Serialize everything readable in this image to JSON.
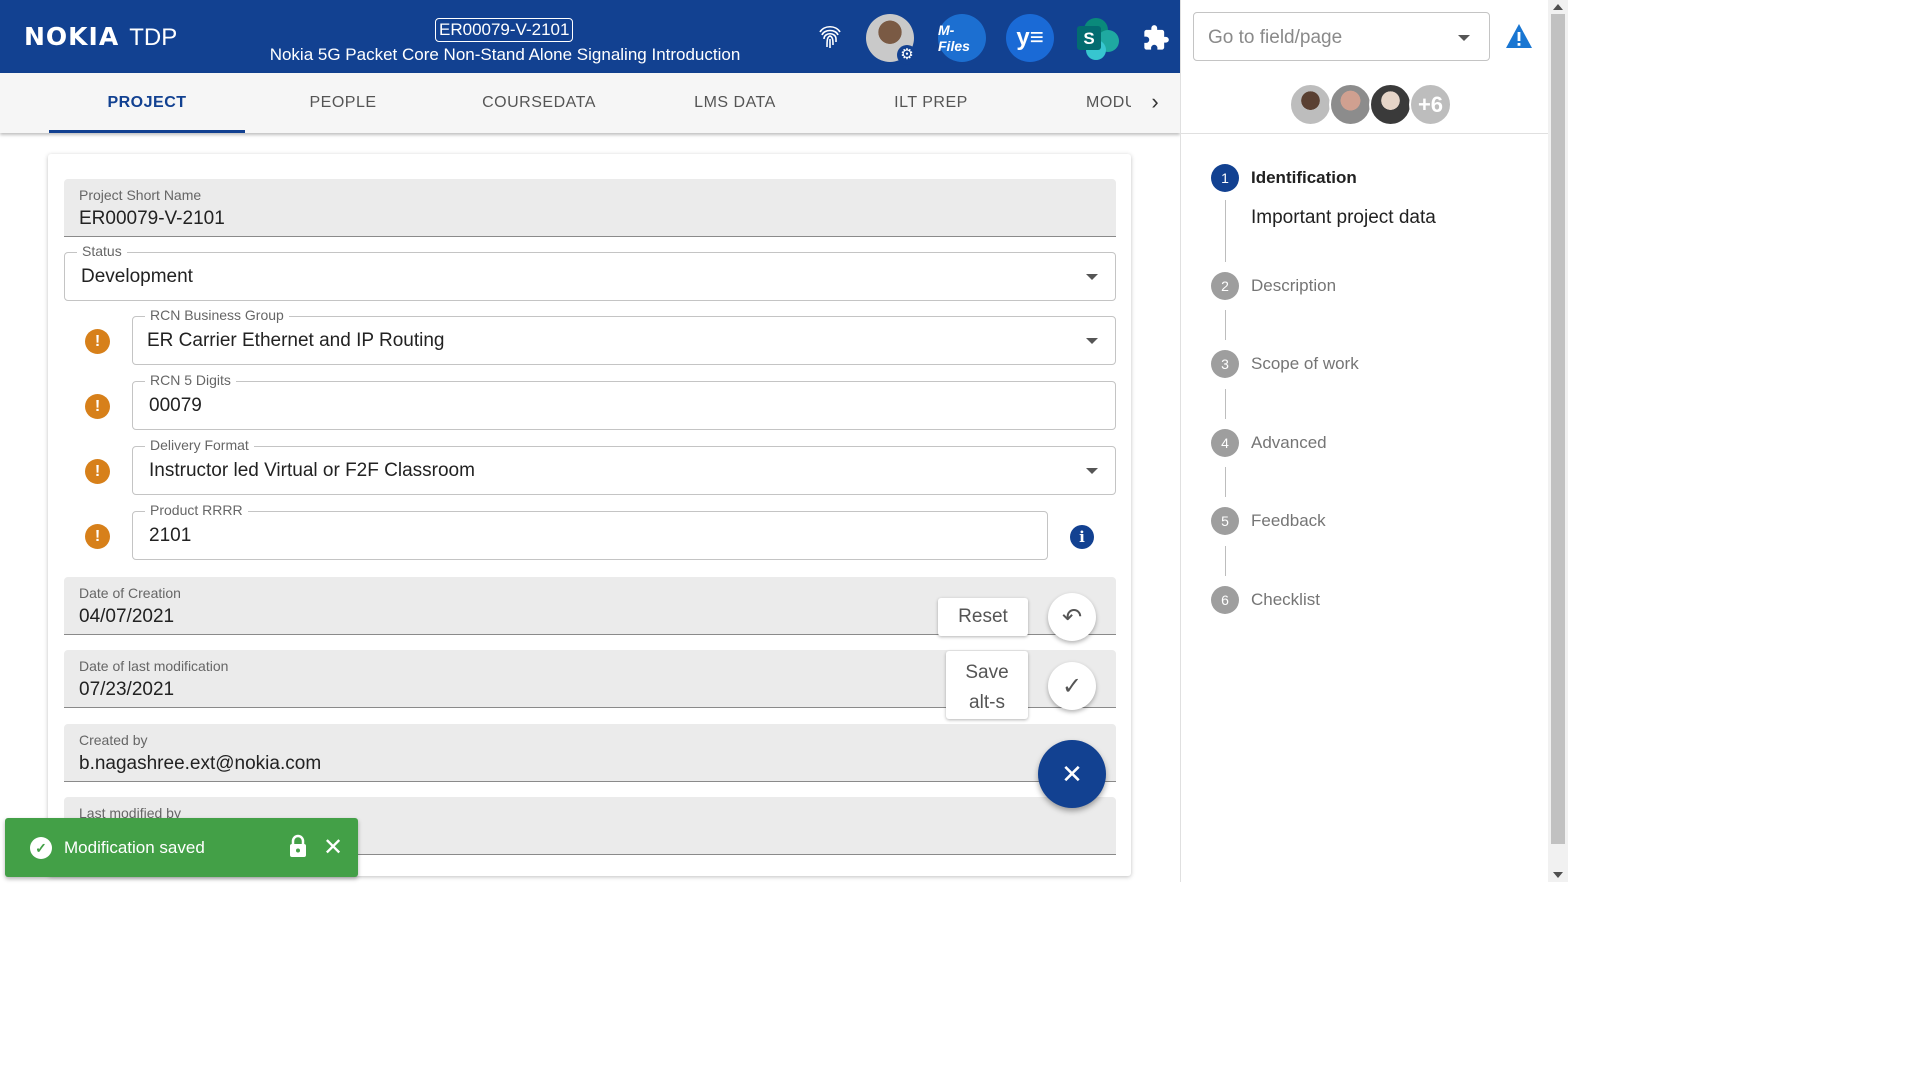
{
  "header": {
    "brand_logo": "NOKIA",
    "brand_app": "TDP",
    "project_id": "ER00079-V-2101",
    "project_title": "Nokia 5G Packet Core Non-Stand Alone Signaling Introduction",
    "mfiles_label": "M-Files",
    "yammer_label": "y≡",
    "sharepoint_label": "S"
  },
  "tabs": [
    {
      "label": "PROJECT",
      "active": true
    },
    {
      "label": "PEOPLE"
    },
    {
      "label": "COURSEDATA"
    },
    {
      "label": "LMS DATA"
    },
    {
      "label": "ILT PREP"
    },
    {
      "label": "MODU"
    }
  ],
  "form": {
    "project_short_name": {
      "label": "Project Short Name",
      "value": "ER00079-V-2101"
    },
    "status": {
      "label": "Status",
      "value": "Development"
    },
    "rcn_business_group": {
      "label": "RCN Business Group",
      "value": "ER Carrier Ethernet and IP Routing"
    },
    "rcn_5_digits": {
      "label": "RCN 5 Digits",
      "value": "00079"
    },
    "delivery_format": {
      "label": "Delivery Format",
      "value": "Instructor led Virtual or F2F Classroom"
    },
    "product_rrrr": {
      "label": "Product RRRR",
      "value": "2101"
    },
    "date_of_creation": {
      "label": "Date of Creation",
      "value": "04/07/2021"
    },
    "date_last_modification": {
      "label": "Date of last modification",
      "value": "07/23/2021"
    },
    "created_by": {
      "label": "Created by",
      "value": "b.nagashree.ext@nokia.com"
    },
    "last_modified_by": {
      "label": "Last modified by",
      "value": ""
    },
    "warning_glyph": "!",
    "info_glyph": "i"
  },
  "actions": {
    "reset_label": "Reset",
    "save_label": "Save",
    "save_shortcut": "alt-s",
    "undo_glyph": "↶",
    "check_glyph": "✓",
    "close_glyph": "✕"
  },
  "toast": {
    "message": "Modification saved",
    "lock_glyph": "🔒",
    "close_glyph": "✕",
    "ok_glyph": "✓",
    "color": "#43a047"
  },
  "sidebar": {
    "goto_placeholder": "Go to field/page",
    "more_people": "+6",
    "steps": [
      {
        "num": "1",
        "name": "Identification",
        "active": true
      },
      {
        "num": "2",
        "name": "Description"
      },
      {
        "num": "3",
        "name": "Scope of work"
      },
      {
        "num": "4",
        "name": "Advanced"
      },
      {
        "num": "5",
        "name": "Feedback"
      },
      {
        "num": "6",
        "name": "Checklist"
      }
    ],
    "active_step_subtitle": "Important project data"
  },
  "colors": {
    "brand_blue": "#124191",
    "warning_orange": "#d7801a"
  },
  "icons": [
    "fingerprint-icon",
    "gear-icon",
    "puzzle-icon",
    "warning-triangle-icon",
    "chevron-right-icon",
    "undo-icon",
    "check-icon",
    "close-icon",
    "lock-icon",
    "check-circle-icon",
    "info-icon"
  ]
}
